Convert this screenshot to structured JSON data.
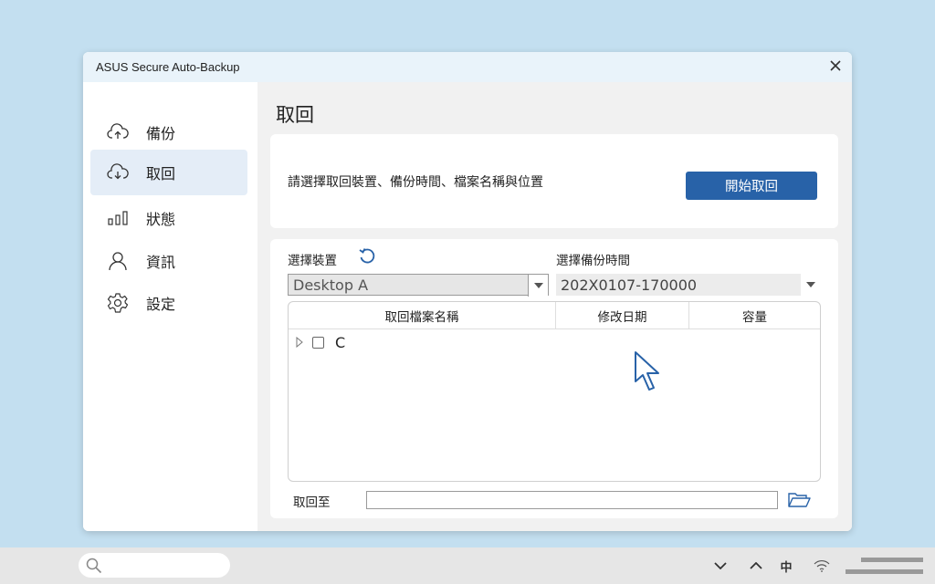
{
  "window": {
    "title": "ASUS Secure Auto-Backup"
  },
  "sidebar": {
    "items": [
      {
        "label": "備份",
        "icon": "cloud-upload-icon"
      },
      {
        "label": "取回",
        "icon": "cloud-download-icon",
        "active": true
      },
      {
        "label": "狀態",
        "icon": "bar-chart-icon"
      },
      {
        "label": "資訊",
        "icon": "user-icon"
      },
      {
        "label": "設定",
        "icon": "gear-icon"
      }
    ]
  },
  "main": {
    "title": "取回",
    "instruction": "請選擇取回裝置、備份時間、檔案名稱與位置",
    "start_button": "開始取回",
    "device_label": "選擇裝置",
    "device_value": "Desktop A",
    "time_label": "選擇備份時間",
    "time_value": "202X0107-170000",
    "table": {
      "columns": [
        "取回檔案名稱",
        "修改日期",
        "容量"
      ],
      "rows": [
        {
          "name": "C"
        }
      ]
    },
    "destination_label": "取回至",
    "destination_value": ""
  },
  "taskbar": {
    "ime": "中"
  },
  "colors": {
    "accent": "#2862a8",
    "background": "#c3dff0",
    "active_nav": "#e4edf7"
  }
}
